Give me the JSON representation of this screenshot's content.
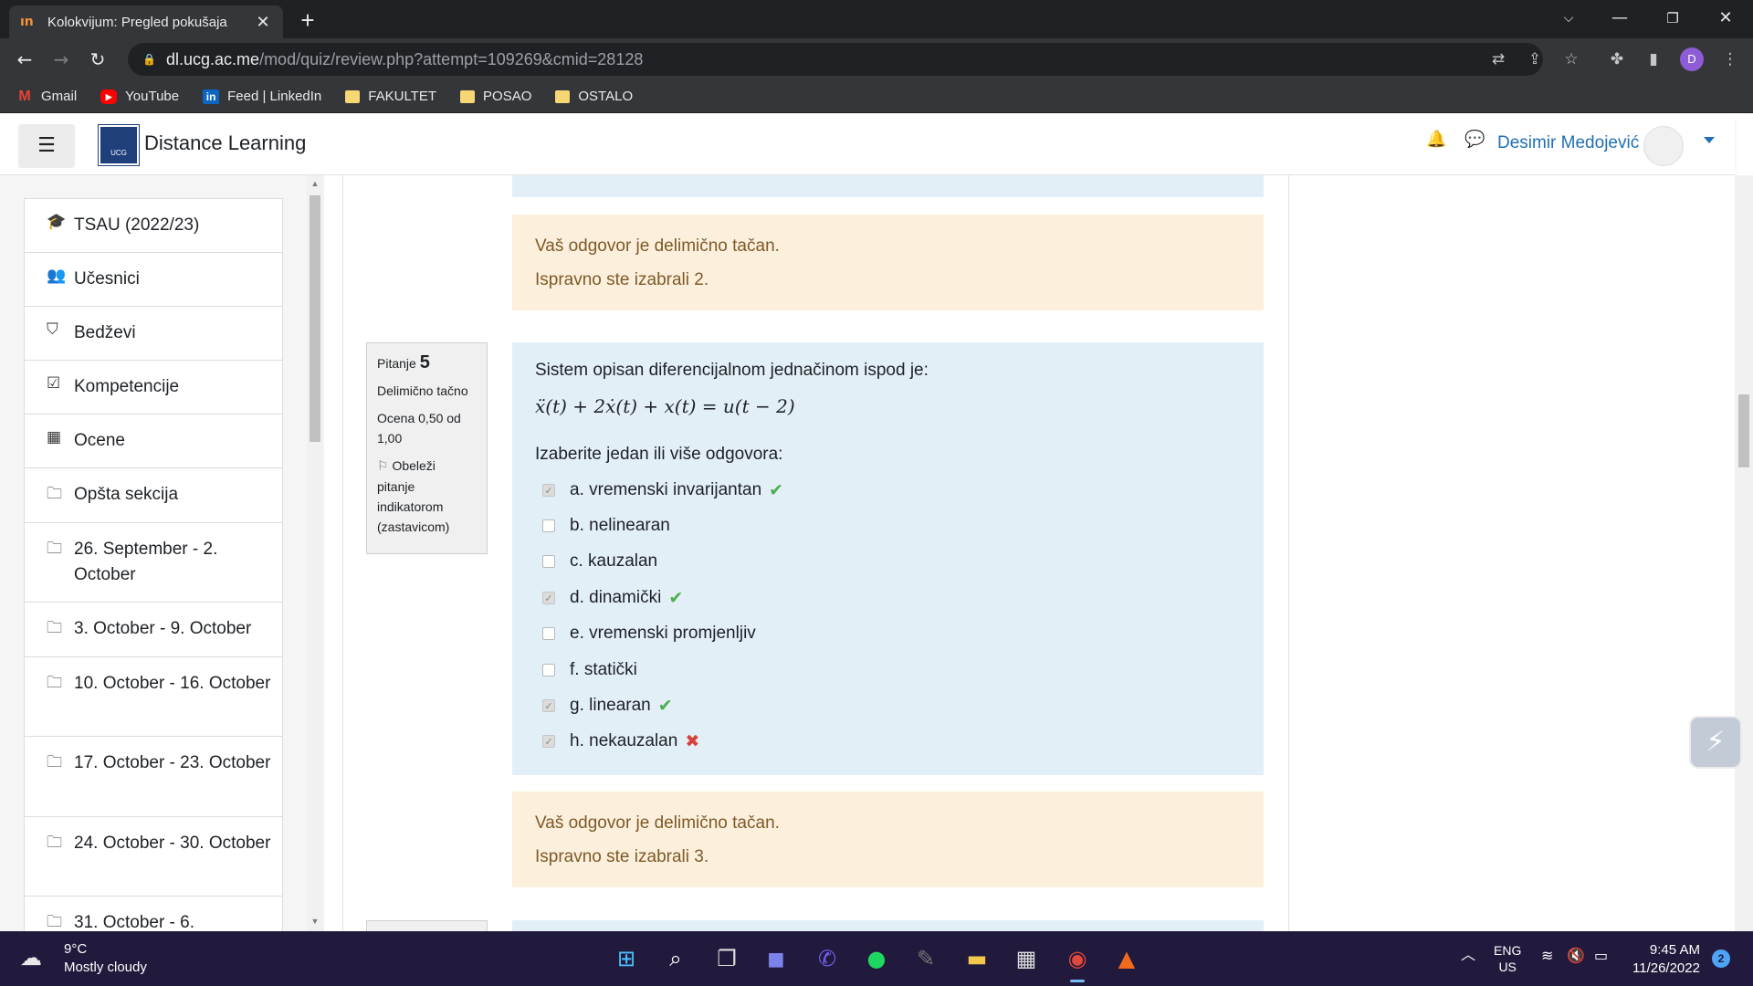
{
  "browser": {
    "tab_title": "Kolokvijum: Pregled pokušaja",
    "tab_close": "✕",
    "new_tab": "+",
    "url_host": "dl.ucg.ac.me",
    "url_path": "/mod/quiz/review.php?attempt=109269&cmid=28128",
    "profile_initial": "D",
    "bookmarks": [
      "Gmail",
      "YouTube",
      "Feed | LinkedIn",
      "FAKULTET",
      "POSAO",
      "OSTALO"
    ]
  },
  "header": {
    "site_name": "Distance Learning",
    "user_name": "Desimir Medojević",
    "logo_text": "UCG"
  },
  "sidebar": {
    "items": [
      {
        "icon": "graduation-cap-icon",
        "label": "TSAU (2022/23)"
      },
      {
        "icon": "users-icon",
        "label": "Učesnici"
      },
      {
        "icon": "shield-icon",
        "label": "Bedževi"
      },
      {
        "icon": "checkbox-icon",
        "label": "Kompetencije"
      },
      {
        "icon": "table-icon",
        "label": "Ocene"
      },
      {
        "icon": "folder-icon",
        "label": "Opšta sekcija"
      },
      {
        "icon": "folder-icon",
        "label": "26. September - 2. October"
      },
      {
        "icon": "folder-icon",
        "label": "3. October - 9. October"
      },
      {
        "icon": "folder-icon",
        "label": "10. October - 16. October"
      },
      {
        "icon": "folder-icon",
        "label": "17. October - 23. October"
      },
      {
        "icon": "folder-icon",
        "label": "24. October - 30. October"
      },
      {
        "icon": "folder-icon",
        "label": "31. October - 6."
      }
    ]
  },
  "feedback_prev": {
    "line1": "Vaš odgovor je delimično tačan.",
    "line2": "Ispravno ste izabrali 2."
  },
  "question": {
    "label": "Pitanje",
    "number": "5",
    "state": "Delimično tačno",
    "grade": "Ocena 0,50 od 1,00",
    "flag": "Obeleži pitanje indikatorom (zastavicom)",
    "text": "Sistem opisan diferencijalnom jednačinom ispod je:",
    "formula": "ẍ(t) + 2ẋ(t) + x(t) = u(t − 2)",
    "prompt": "Izaberite jedan ili više odgovora:",
    "answers": [
      {
        "label": "a. vremenski invarijantan",
        "checked": true,
        "mark": "✔"
      },
      {
        "label": "b. nelinearan",
        "checked": false,
        "mark": ""
      },
      {
        "label": "c. kauzalan",
        "checked": false,
        "mark": ""
      },
      {
        "label": "d. dinamički",
        "checked": true,
        "mark": "✔"
      },
      {
        "label": "e. vremenski promjenljiv",
        "checked": false,
        "mark": ""
      },
      {
        "label": "f. statički",
        "checked": false,
        "mark": ""
      },
      {
        "label": "g. linearan",
        "checked": true,
        "mark": "✔"
      },
      {
        "label": "h. nekauzalan",
        "checked": true,
        "mark": "✖"
      }
    ]
  },
  "feedback_current": {
    "line1": "Vaš odgovor je delimično tačan.",
    "line2": "Ispravno ste izabrali 3."
  },
  "taskbar": {
    "temperature": "9°C",
    "weather": "Mostly cloudy",
    "lang1": "ENG",
    "lang2": "US",
    "time": "9:45 AM",
    "date": "11/26/2022",
    "notifications": "2"
  },
  "colors": {
    "question_bg": "#e3eff7",
    "feedback_bg": "#fcefdc",
    "correct": "#4caf50",
    "incorrect": "#d9413a",
    "link": "#1f6fb5"
  }
}
